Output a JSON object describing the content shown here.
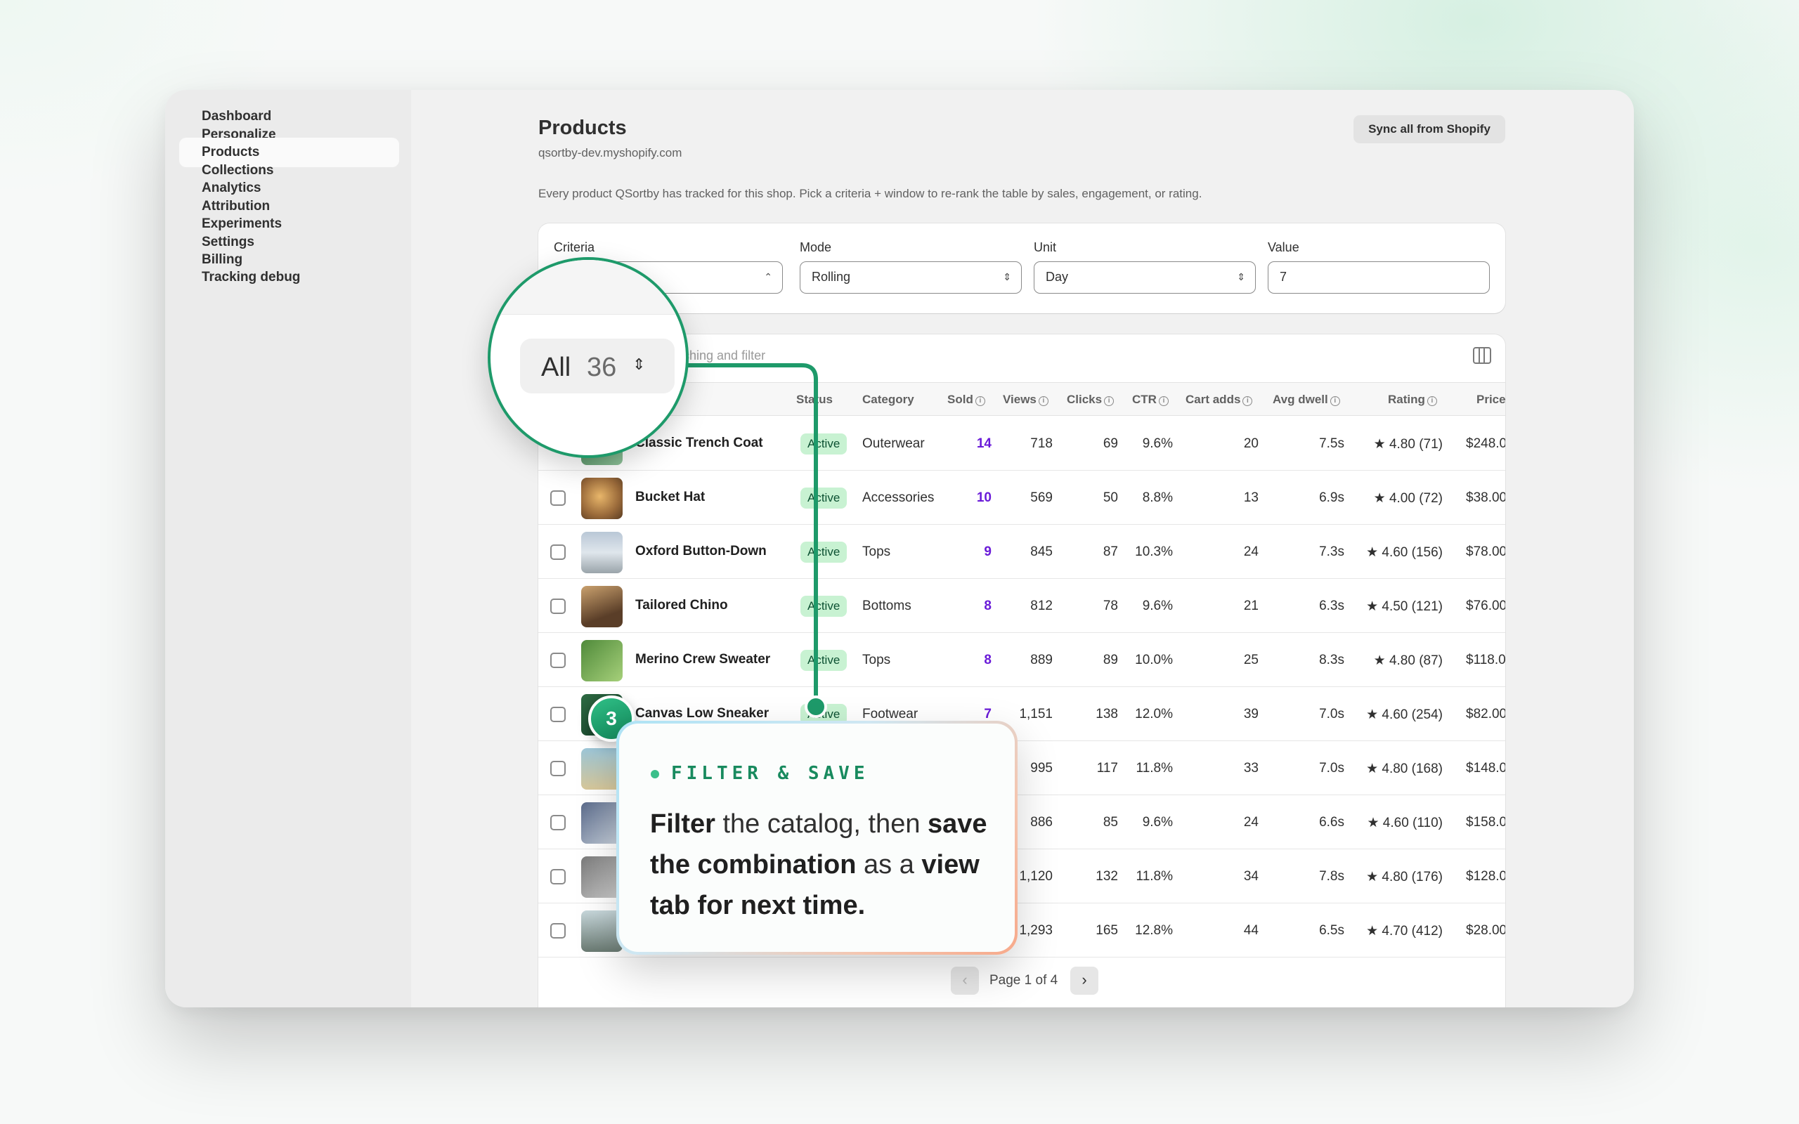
{
  "sidebar": {
    "items": [
      {
        "label": "Dashboard"
      },
      {
        "label": "Personalize"
      },
      {
        "label": "Products",
        "active": true
      },
      {
        "label": "Collections"
      },
      {
        "label": "Analytics"
      },
      {
        "label": "Attribution"
      },
      {
        "label": "Experiments"
      },
      {
        "label": "Settings"
      },
      {
        "label": "Billing"
      },
      {
        "label": "Tracking debug"
      }
    ]
  },
  "header": {
    "title": "Products",
    "subtitle": "qsortby-dev.myshopify.com",
    "sync_label": "Sync all from Shopify",
    "description": "Every product QSortby has tracked for this shop. Pick a criteria + window to re-rank the table by sales, engagement, or rating."
  },
  "filters": {
    "criteria": {
      "label": "Criteria",
      "value": ""
    },
    "mode": {
      "label": "Mode",
      "value": "Rolling"
    },
    "unit": {
      "label": "Unit",
      "value": "Day"
    },
    "value": {
      "label": "Value",
      "value": "7"
    }
  },
  "toolbar": {
    "search_hint": "arching and filter"
  },
  "table": {
    "columns": {
      "product": "ct",
      "status": "Status",
      "category": "Category",
      "sold": "Sold",
      "views": "Views",
      "clicks": "Clicks",
      "ctr": "CTR",
      "cart_adds": "Cart adds",
      "avg_dwell": "Avg dwell",
      "rating": "Rating",
      "price": "Price"
    },
    "rows": [
      {
        "name": "Classic Trench Coat",
        "status": "Active",
        "category": "Outerwear",
        "sold": "14",
        "views": "718",
        "clicks": "69",
        "ctr": "9.6%",
        "cart_adds": "20",
        "dwell": "7.5s",
        "rating": "★ 4.80 (71)",
        "price": "$248.00"
      },
      {
        "name": "Bucket Hat",
        "status": "Active",
        "category": "Accessories",
        "sold": "10",
        "views": "569",
        "clicks": "50",
        "ctr": "8.8%",
        "cart_adds": "13",
        "dwell": "6.9s",
        "rating": "★ 4.00 (72)",
        "price": "$38.00"
      },
      {
        "name": "Oxford Button-Down",
        "status": "Active",
        "category": "Tops",
        "sold": "9",
        "views": "845",
        "clicks": "87",
        "ctr": "10.3%",
        "cart_adds": "24",
        "dwell": "7.3s",
        "rating": "★ 4.60 (156)",
        "price": "$78.00"
      },
      {
        "name": "Tailored Chino",
        "status": "Active",
        "category": "Bottoms",
        "sold": "8",
        "views": "812",
        "clicks": "78",
        "ctr": "9.6%",
        "cart_adds": "21",
        "dwell": "6.3s",
        "rating": "★ 4.50 (121)",
        "price": "$76.00"
      },
      {
        "name": "Merino Crew Sweater",
        "status": "Active",
        "category": "Tops",
        "sold": "8",
        "views": "889",
        "clicks": "89",
        "ctr": "10.0%",
        "cart_adds": "25",
        "dwell": "8.3s",
        "rating": "★ 4.80 (87)",
        "price": "$118.00"
      },
      {
        "name": "Canvas Low Sneaker",
        "status": "Active",
        "category": "Footwear",
        "sold": "7",
        "views": "1,151",
        "clicks": "138",
        "ctr": "12.0%",
        "cart_adds": "39",
        "dwell": "7.0s",
        "rating": "★ 4.60 (254)",
        "price": "$82.00"
      },
      {
        "name": "",
        "status": "",
        "category": "",
        "sold": "",
        "views": "995",
        "clicks": "117",
        "ctr": "11.8%",
        "cart_adds": "33",
        "dwell": "7.0s",
        "rating": "★ 4.80 (168)",
        "price": "$148.00"
      },
      {
        "name": "",
        "status": "",
        "category": "",
        "sold": "",
        "views": "886",
        "clicks": "85",
        "ctr": "9.6%",
        "cart_adds": "24",
        "dwell": "6.6s",
        "rating": "★ 4.60 (110)",
        "price": "$158.00"
      },
      {
        "name": "",
        "status": "",
        "category": "",
        "sold": "",
        "views": "1,120",
        "clicks": "132",
        "ctr": "11.8%",
        "cart_adds": "34",
        "dwell": "7.8s",
        "rating": "★ 4.80 (176)",
        "price": "$128.00"
      },
      {
        "name": "",
        "status": "",
        "category": "",
        "sold": "",
        "views": "1,293",
        "clicks": "165",
        "ctr": "12.8%",
        "cart_adds": "44",
        "dwell": "6.5s",
        "rating": "★ 4.70 (412)",
        "price": "$28.00"
      }
    ]
  },
  "pagination": {
    "label": "Page 1 of 4",
    "prev": "‹",
    "next": "›"
  },
  "magnifier": {
    "all_label": "All",
    "count": "36",
    "chevron": "⌃⌄"
  },
  "callout": {
    "step": "3",
    "tag": "FILTER & SAVE",
    "text_bold_1": "Filter",
    "text_light_1": "the catalog, then",
    "text_bold_2": "save the combination",
    "text_light_2": "as a",
    "text_bold_3": "view tab for next time."
  },
  "colors": {
    "accent_green": "#1e9a6a",
    "badge_bg": "#c8f2d2",
    "sold_purple": "#6a1bd8"
  },
  "icons": {
    "select_chevron": "up-down-chevron-icon",
    "columns": "columns-icon",
    "info": "info-icon"
  }
}
